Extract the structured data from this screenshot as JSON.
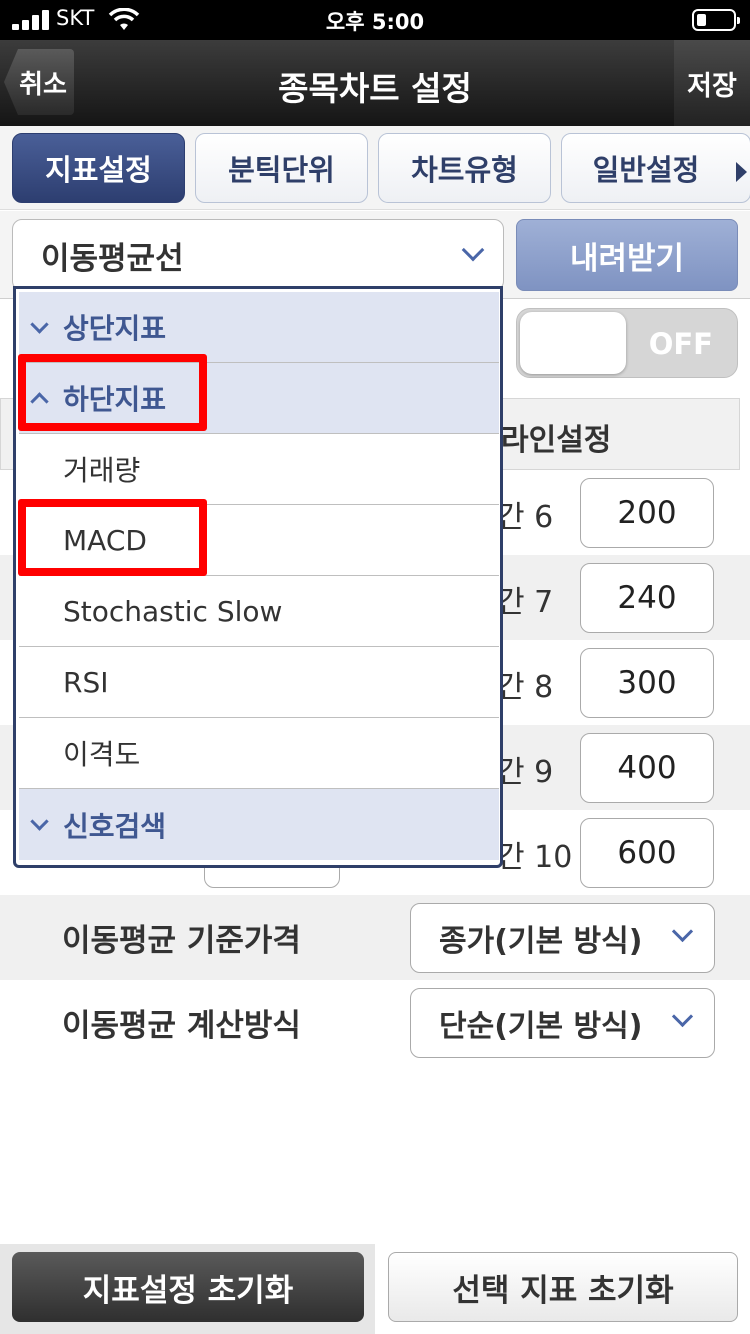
{
  "status_bar": {
    "carrier": "SKT",
    "time": "오후 5:00"
  },
  "nav": {
    "cancel_label": "취소",
    "title": "종목차트 설정",
    "save_label": "저장"
  },
  "tabs": [
    {
      "label": "지표설정",
      "active": true
    },
    {
      "label": "분틱단위",
      "active": false
    },
    {
      "label": "차트유형",
      "active": false
    },
    {
      "label": "일반설정",
      "active": false
    }
  ],
  "indicator_select": {
    "value": "이동평균선"
  },
  "download_label": "내려받기",
  "toggle": {
    "state": "OFF"
  },
  "line_setting_header": "라인설정",
  "periods": [
    {
      "label": "간 6",
      "value": "200"
    },
    {
      "label": "간 7",
      "value": "240"
    },
    {
      "label": "간 8",
      "value": "300"
    },
    {
      "label": "간 9",
      "value": "400"
    },
    {
      "label": "간 10",
      "value": "600"
    }
  ],
  "settings": [
    {
      "label": "이동평균 기준가격",
      "value": "종가(기본 방식)"
    },
    {
      "label": "이동평균 계산방식",
      "value": "단순(기본 방식)"
    }
  ],
  "dropdown": {
    "sections": [
      {
        "label": "상단지표",
        "expanded": false
      },
      {
        "label": "하단지표",
        "expanded": true
      },
      {
        "label": "신호검색",
        "expanded": false
      }
    ],
    "items": [
      "거래량",
      "MACD",
      "Stochastic Slow",
      "RSI",
      "이격도"
    ]
  },
  "bottom": {
    "reset_all_label": "지표설정 초기화",
    "reset_selected_label": "선택 지표 초기화"
  },
  "colors": {
    "accent": "#2d3e70",
    "highlight": "#ff0000"
  }
}
